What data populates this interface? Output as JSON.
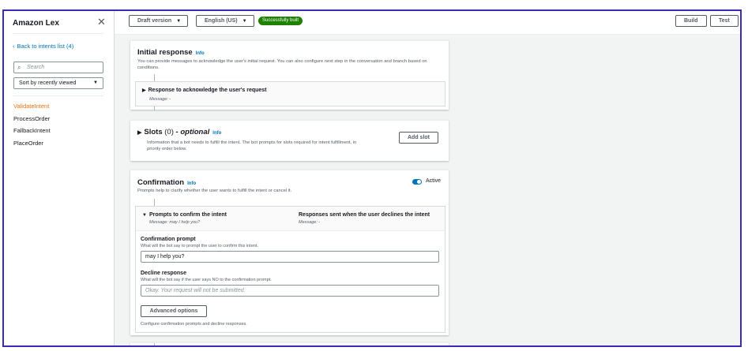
{
  "sidebar": {
    "title": "Amazon Lex",
    "back_link": "Back to intents list (4)",
    "search_placeholder": "Search",
    "sort_label": "Sort by recently viewed",
    "intents": [
      "ValidateIntent",
      "ProcessOrder",
      "FallbackIntent",
      "PlaceOrder"
    ],
    "active_intent": "ValidateIntent"
  },
  "topbar": {
    "version": "Draft version",
    "language": "English (US)",
    "status": "Successfully built",
    "build": "Build",
    "test": "Test"
  },
  "initial_response": {
    "title": "Initial response",
    "info": "Info",
    "description": "You can provide messages to acknowledge the user's initial request. You can also configure next step in the conversation and branch based on conditions.",
    "row_label": "Response to acknowledge the user's request",
    "row_message": "Message: -"
  },
  "slots": {
    "title": "Slots",
    "count": "(0)",
    "optional": "- optional",
    "info": "Info",
    "description": "Information that a bot needs to fulfill the intent. The bot prompts for slots required for intent fulfillment, in priority order below.",
    "add_button": "Add slot"
  },
  "confirmation": {
    "title": "Confirmation",
    "info": "Info",
    "description": "Prompts help to clarify whether the user wants to fulfill the intent or cancel it.",
    "active_label": "Active",
    "active": true,
    "prompts_header": "Prompts to confirm the intent",
    "prompts_message": "Message: may I help you?",
    "decline_header": "Responses sent when the user declines the intent",
    "decline_message": "Message: -",
    "confirmation_prompt_label": "Confirmation prompt",
    "confirmation_prompt_desc": "What will the bot say to prompt the user to confirm this intent.",
    "confirmation_prompt_value": "may I help you?",
    "decline_label": "Decline response",
    "decline_desc": "What will the bot say if the user says NO to the confirmation prompt.",
    "decline_placeholder": "Okay. Your request will not be submitted.",
    "advanced_button": "Advanced options",
    "footer_text": "Configure confirmation prompts and decline responses."
  },
  "colors": {
    "accent": "#0073bb",
    "active_intent": "#ec7211",
    "success": "#1d8102",
    "frame": "#3a2bb5"
  },
  "icons": {
    "close": "close-icon",
    "back": "chevron-left-icon",
    "search": "search-icon",
    "dropdown": "caret-down-icon",
    "expand": "caret-right-icon",
    "collapse": "caret-down-icon",
    "toggle": "toggle-icon"
  }
}
